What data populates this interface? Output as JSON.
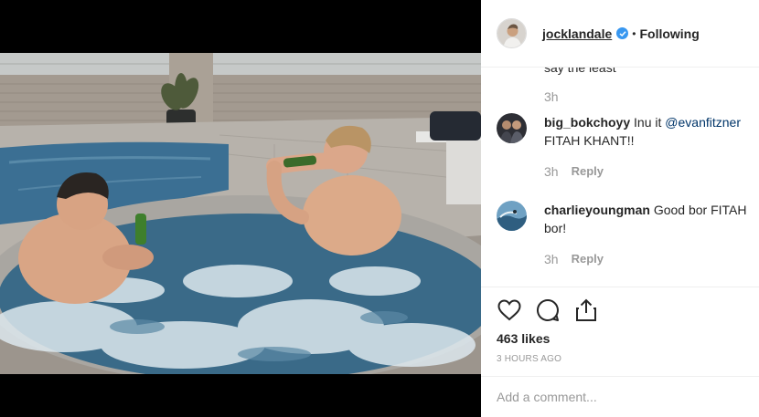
{
  "post": {
    "username": "jocklandale",
    "follow_status": "Following",
    "separator": "•"
  },
  "comments": {
    "truncated_text": "say the least",
    "truncated_time": "3h",
    "items": [
      {
        "username": "big_bokchoyy",
        "text_before": "Inu it",
        "mention": "@evanfitzner",
        "text_after": "FITAH KHANT!!",
        "time": "3h",
        "reply_label": "Reply"
      },
      {
        "username": "charlieyoungman",
        "text_before": "Good bor FITAH bor!",
        "mention": "",
        "text_after": "",
        "time": "3h",
        "reply_label": "Reply"
      }
    ]
  },
  "actions": {
    "icons": [
      "heart-icon",
      "comment-icon",
      "share-icon"
    ]
  },
  "likes": {
    "label": "463 likes"
  },
  "timestamp": "3 HOURS AGO",
  "add_comment": {
    "placeholder": "Add a comment..."
  },
  "colors": {
    "verified": "#3897f0",
    "mention": "#003569",
    "muted": "#999999"
  }
}
